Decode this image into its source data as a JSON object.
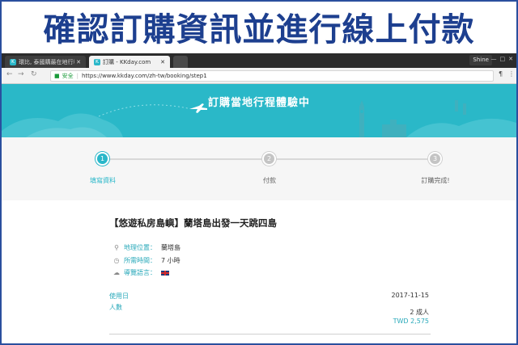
{
  "banner": {
    "title": "確認訂購資訊並進行線上付款"
  },
  "browser": {
    "tabs": [
      {
        "label": "環比, 泰國購最在地行程"
      },
      {
        "label": "訂購 - KKday.com"
      }
    ],
    "profile": "Shine",
    "window_controls": [
      "—",
      "□",
      "✕"
    ],
    "address": {
      "secure_label": "安全",
      "url": "https://www.kkday.com/zh-tw/booking/step1"
    }
  },
  "hero": {
    "title": "訂購當地行程體驗中"
  },
  "stepper": {
    "steps": [
      {
        "number": "1",
        "label": "填寫資料",
        "active": true
      },
      {
        "number": "2",
        "label": "付款",
        "active": false
      },
      {
        "number": "3",
        "label": "訂購完成!",
        "active": false
      }
    ]
  },
  "product": {
    "title": "【悠遊私房島嶼】蘭塔島出發一天跳四島",
    "info": [
      {
        "icon": "map-pin-icon",
        "label": "地理位置：",
        "value": "蘭塔島"
      },
      {
        "icon": "clock-icon",
        "label": "所需時間：",
        "value": "7 小時"
      },
      {
        "icon": "chat-icon",
        "label": "導覽語言：",
        "value": ""
      }
    ]
  },
  "order": {
    "date_label": "使用日",
    "date_value": "2017-11-15",
    "people_label": "人數",
    "people_value": "2 成人",
    "price": "TWD 2,575"
  },
  "colors": {
    "accent": "#29b7c9",
    "banner_text": "#1d3f8f",
    "hero_bg": "#2ab8c8"
  }
}
